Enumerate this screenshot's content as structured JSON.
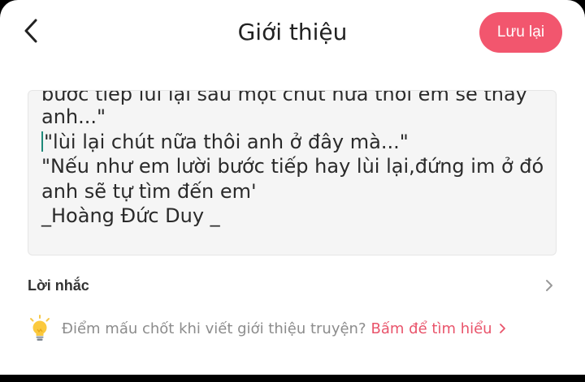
{
  "header": {
    "title": "Giới thiệu",
    "save_label": "Lưu lại"
  },
  "editor": {
    "lines": [
      "bước tiếp lùi lại sau một chút nữa thôi em sẽ thấy",
      "anh...\"",
      "\"lùi lại chút nữa thôi anh ở đây mà...\"",
      "\"Nếu như em lười bước tiếp hay lùi lại,đứng im ở đó",
      "anh sẽ tự tìm đến em'",
      "_Hoàng Đức Duy _"
    ]
  },
  "hint": {
    "label": "Lời nhắc",
    "tip_text": "Điểm mấu chốt khi viết giới thiệu truyện?",
    "tip_link": "Bấm để tìm hiểu"
  },
  "colors": {
    "accent": "#f2566e",
    "link": "#e9546b",
    "caret": "#1f8a7a"
  }
}
